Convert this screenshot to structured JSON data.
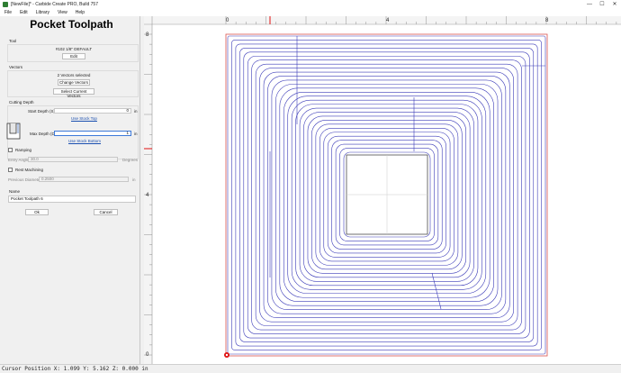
{
  "window": {
    "title": "[NewFile]* - Carbide Create PRO, Build 757",
    "minimize": "—",
    "maximize": "☐",
    "close": "✕"
  },
  "menu": [
    "File",
    "Edit",
    "Library",
    "View",
    "Help"
  ],
  "panel": {
    "title": "Pocket Toolpath",
    "tool": {
      "label": "Tool",
      "name": "#102 1/8\" DEFAULT",
      "edit_button": "Edit"
    },
    "vectors": {
      "label": "Vectors",
      "selected_text": "2 Vectors selected",
      "change_button": "Change Vectors",
      "select_button": "Select Current Vectors"
    },
    "cutting_depth": {
      "label": "Cutting Depth",
      "start_label": "Start Depth (S)",
      "start_value": "0",
      "start_unit": "in",
      "start_link": "Use Stock Top",
      "max_label": "Max Depth (D)",
      "max_value": "1",
      "max_unit": "in",
      "max_link": "Use Stock Bottom"
    },
    "ramping": {
      "label": "Ramping",
      "checked": false,
      "angle_label": "Entry Angle",
      "angle_value": "30.0",
      "angle_unit": "Degrees"
    },
    "rest": {
      "label": "Rest Machining",
      "checked": false,
      "diameter_label": "Previous Diameter",
      "diameter_value": "0.2500",
      "diameter_unit": "in"
    },
    "name": {
      "label": "Name",
      "value": "Pocket Toolpath 6"
    },
    "ok_button": "Ok",
    "cancel_button": "Cancel"
  },
  "canvas": {
    "top_ruler_labels": [
      "0",
      "4",
      "8"
    ],
    "left_ruler_labels": [
      "8",
      "4",
      "0"
    ],
    "units_per_inch": 1,
    "toolpath_color": "#3b3bb8",
    "boundary_color": "#d9534f",
    "cursor_color": "#e01010"
  },
  "status": {
    "text": "Cursor Position X: 1.099 Y: 5.162 Z: 0.000 in"
  }
}
